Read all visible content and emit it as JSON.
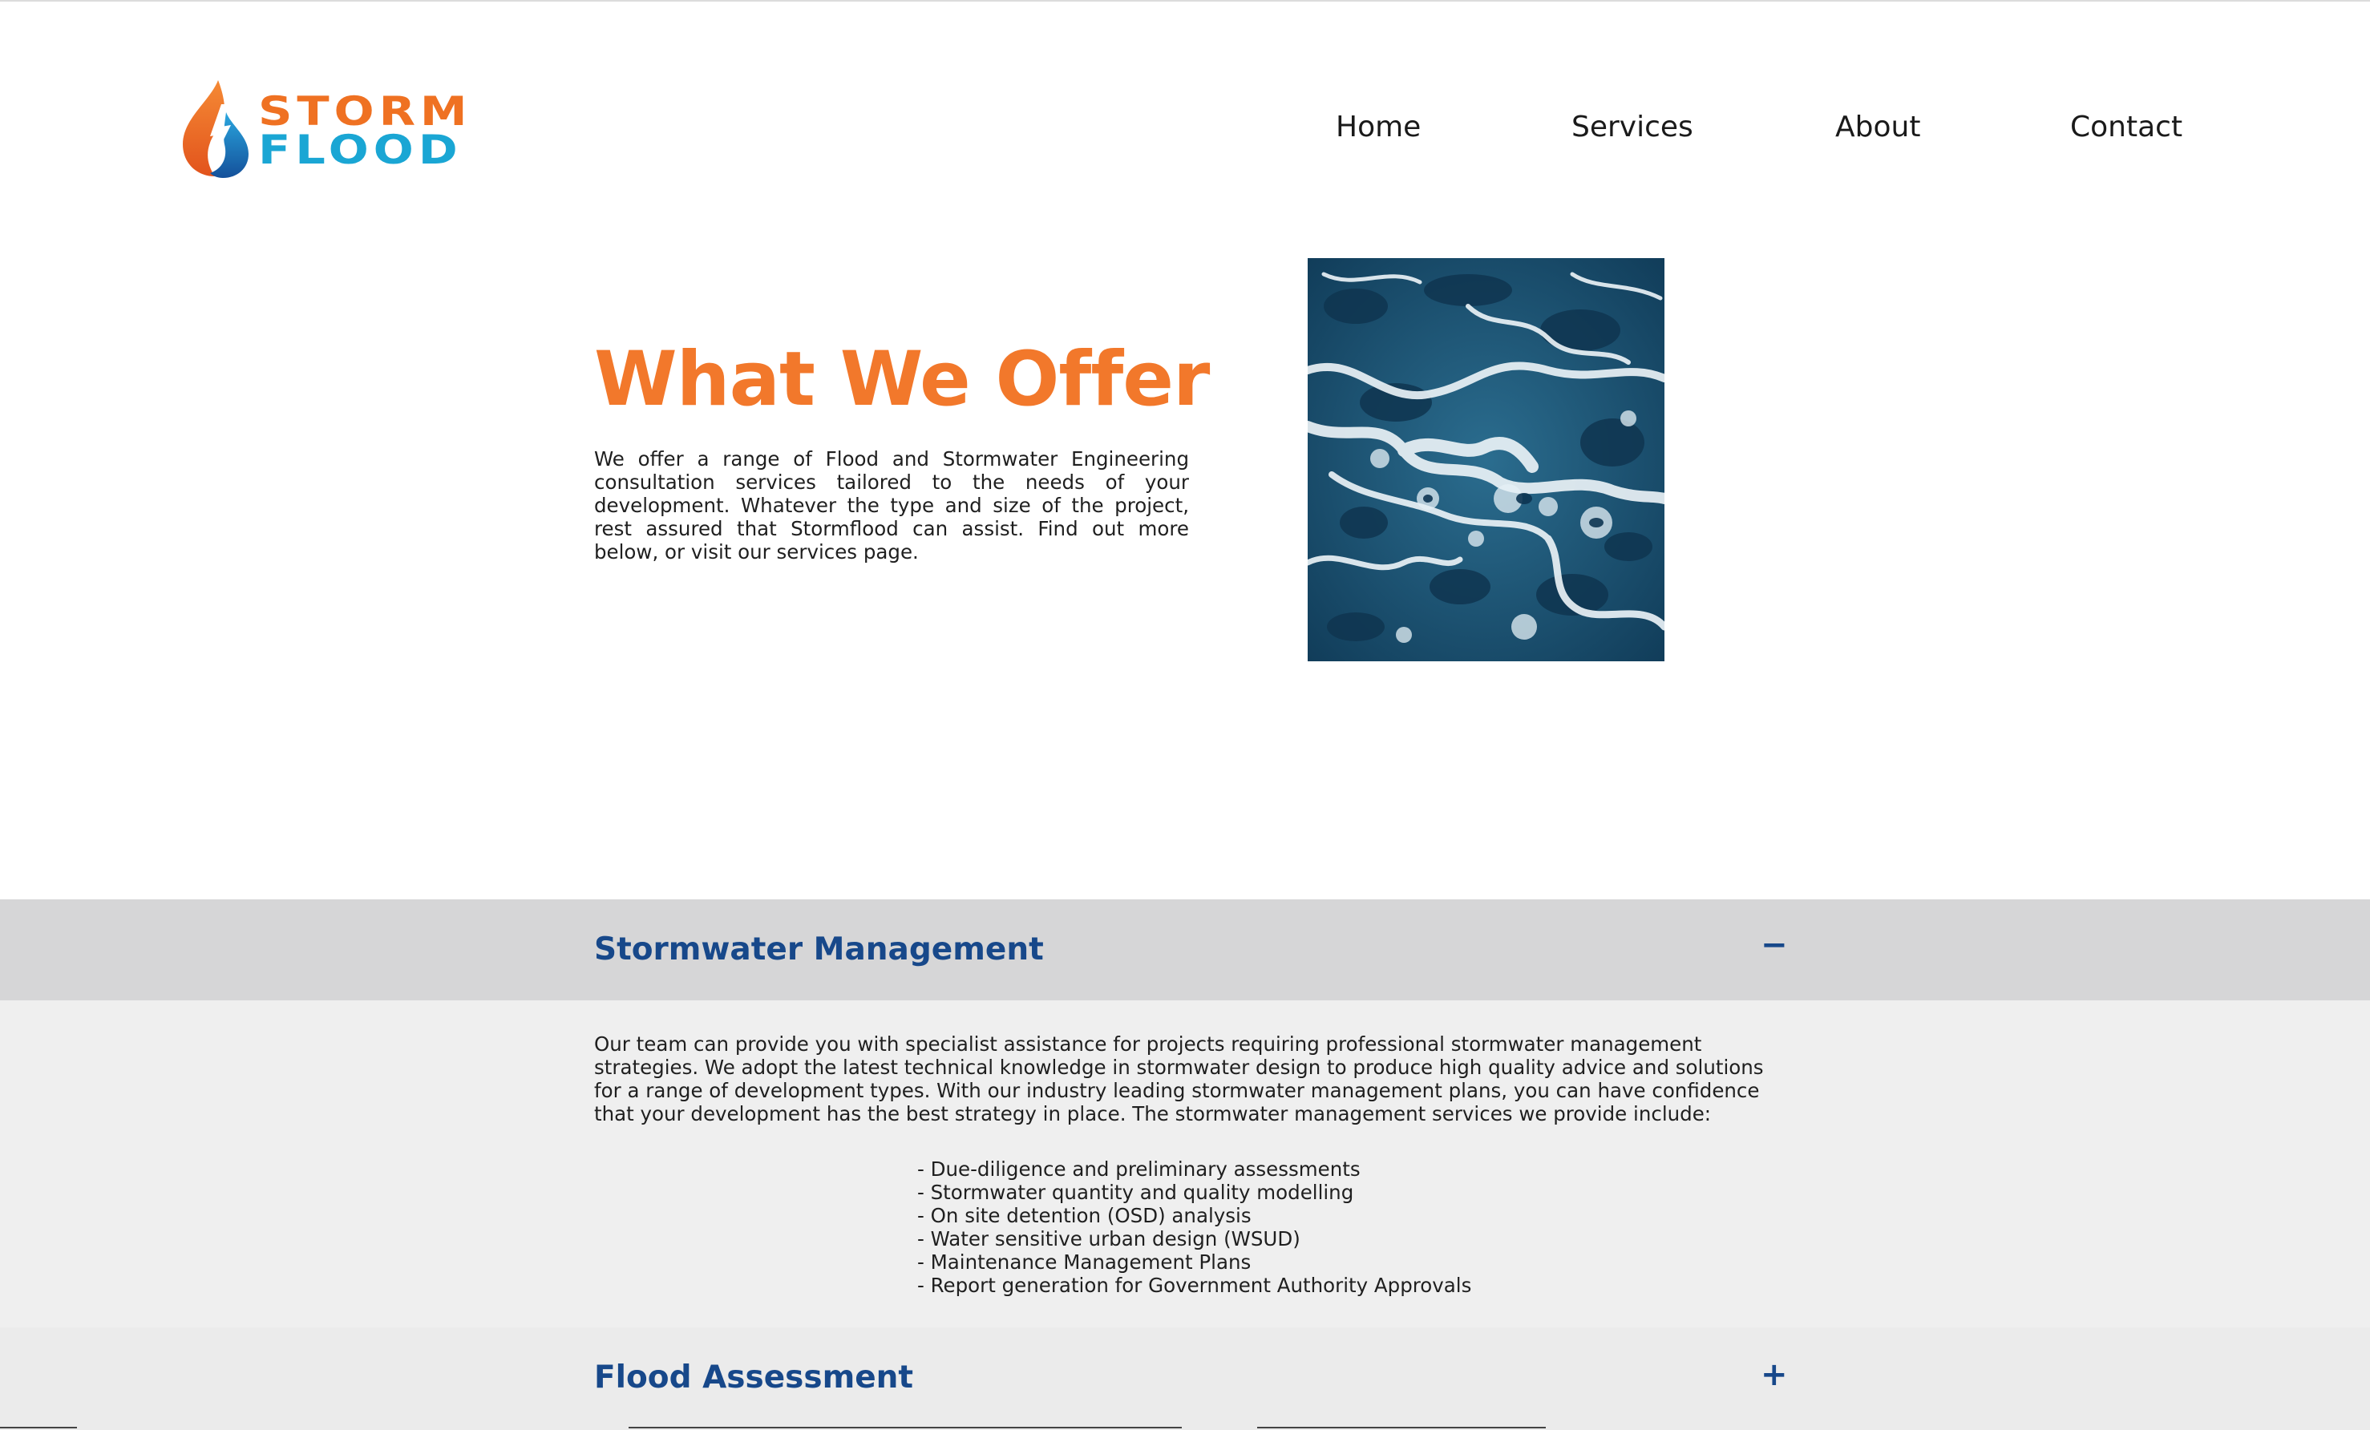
{
  "header": {
    "logo": {
      "line1": "STORM",
      "line2": "FLOOD",
      "colors": {
        "orange": "#ef7122",
        "blue": "#1aa6d4"
      }
    },
    "nav": [
      {
        "label": "Home"
      },
      {
        "label": "Services"
      },
      {
        "label": "About"
      },
      {
        "label": "Contact"
      }
    ]
  },
  "hero": {
    "title": "What We Offer",
    "body": "We offer a range of Flood and Stormwater Engineering consultation services tailored to the needs of your development. Whatever the type and size of the project, rest assured that Stormflood can assist. Find out more below, or visit our services page.",
    "image_icon": "ocean-waves-photo"
  },
  "accordion": [
    {
      "title": "Stormwater Management",
      "toggle": "−",
      "expanded": true,
      "description": "Our team can provide you with specialist assistance for projects requiring professional stormwater management strategies. We adopt the latest technical knowledge in stormwater design to produce high quality advice and solutions for a range of development types. With our industry leading stormwater management plans, you can have confidence that your development has the best strategy in place. The stormwater management services we provide include:",
      "items": [
        "- Due-diligence and preliminary assessments",
        "- Stormwater quantity and quality modelling",
        "- On site detention (OSD) analysis",
        "- Water sensitive urban design (WSUD)",
        "- Maintenance Management Plans",
        "- Report generation for Government Authority Approvals"
      ]
    },
    {
      "title": "Flood Assessment",
      "toggle": "+",
      "expanded": false
    }
  ],
  "colors": {
    "accent_orange": "#f2782b",
    "heading_blue": "#17488a",
    "accordion_header_bg": "#d6d6d7",
    "accordion_panel_bg": "#efefef"
  }
}
